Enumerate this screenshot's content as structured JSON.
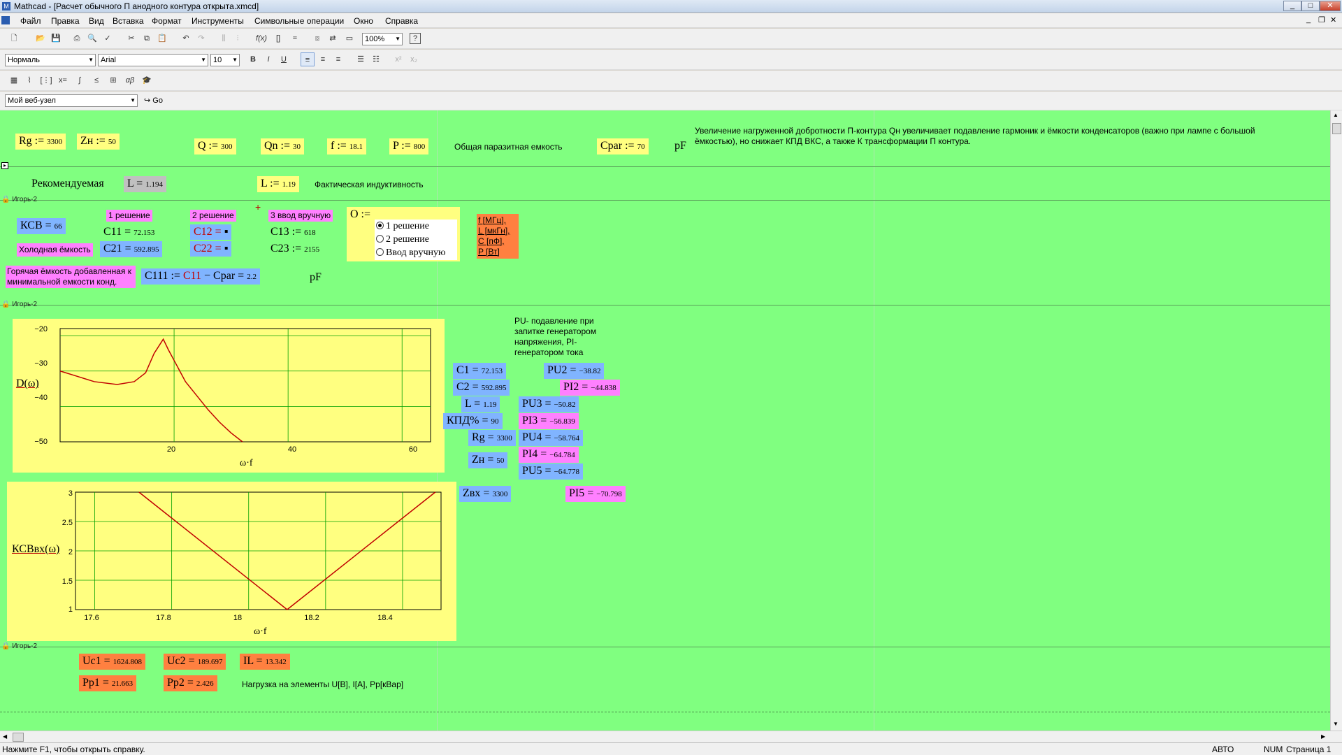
{
  "window": {
    "title": "Mathcad - [Расчет обычного П анодного контура открыта.xmcd]"
  },
  "menu": [
    "Файл",
    "Правка",
    "Вид",
    "Вставка",
    "Формат",
    "Инструменты",
    "Символьные операции",
    "Окно",
    "Справка"
  ],
  "format_bar": {
    "style": "Нормаль",
    "font": "Arial",
    "size": "10",
    "zoom": "100%"
  },
  "web_bar": {
    "site": "Мой веб-узел",
    "go": "Go"
  },
  "region_labels": {
    "r1": "Игорь-2",
    "r2": "Игорь-2",
    "r3": "Игорь-2"
  },
  "row1": {
    "rg": "Rg := ",
    "rg_v": "3300",
    "zn": "Zн := ",
    "zn_v": "50",
    "q": "Q := ",
    "q_v": "300",
    "qn": "Qn := ",
    "qn_v": "30",
    "f": "f := ",
    "f_v": "18.1",
    "p": "P := ",
    "p_v": "800",
    "cpar_label": "Общая паразитная емкость",
    "cpar": "Cpar := ",
    "cpar_v": "70",
    "pf": "pF",
    "note": "Увеличение нагруженной добротности П-контура Qн увеличивает подавление гармоник и ёмкости конденсаторов (важно при лампе с большой ёмкостью), но снижает КПД ВКС, а также К трансформации П контура."
  },
  "row2": {
    "rec": "Рекомендуемая",
    "l": "L = ",
    "l_v": "1.194",
    "lset": "L := ",
    "lset_v": "1.19",
    "lnote": "Фактическая индуктивность"
  },
  "sol": {
    "ksv": "КСВ = ",
    "ksv_v": "66",
    "cold": "Холодная ёмкость",
    "h1": "1 решение",
    "h2": "2 решение",
    "h3": "3 ввод вручную",
    "c11": "C11 = ",
    "c11_v": "72.153",
    "c21": "C21 = ",
    "c21_v": "592.895",
    "c12": "C12 = ",
    "c22": "C22 = ",
    "c13": "C13 := ",
    "c13_v": "618",
    "c23": "C23 := ",
    "c23_v": "2155",
    "o": "O :=",
    "opt1": "1 решение",
    "opt2": "2 решение",
    "opt3": "Ввод вручную",
    "u1": "f [МГц],",
    "u2": "L [мкГн],",
    "u3": "C [пФ],",
    "u4": "P [Вт]",
    "hot": "Горячая ёмкость добавленная к минимальной емкости конд.",
    "c111a": "C111 := ",
    "c111b": "C11",
    "c111c": " − Cpar = ",
    "c111_v": "2.2",
    "pf": "pF"
  },
  "plot1": {
    "ylabel": "D(ω)",
    "xlabel": "ω·f",
    "yticks": [
      "−20",
      "−30",
      "−40",
      "−50"
    ],
    "xticks": [
      "20",
      "40",
      "60"
    ]
  },
  "plot2": {
    "ylabel": "КСВвх(ω)",
    "xlabel": "ω·f",
    "yticks": [
      "3",
      "2.5",
      "2",
      "1.5",
      "1"
    ],
    "xticks": [
      "17.6",
      "17.8",
      "18",
      "18.2",
      "18.4"
    ]
  },
  "results": {
    "note": "PU- подавление при запитке генератором напряжения, PI- генератором тока",
    "c1": "C1 = ",
    "c1_v": "72.153",
    "c2": "C2 = ",
    "c2_v": "592.895",
    "l": "L = ",
    "l_v": "1.19",
    "kpd": "КПД% = ",
    "kpd_v": "90",
    "rg": "Rg = ",
    "rg_v": "3300",
    "zn": "Zн = ",
    "zn_v": "50",
    "zvx": "Zвх = ",
    "zvx_v": "3300",
    "pu2": "PU2 = ",
    "pu2_v": "−38.82",
    "pi2": "PI2 = ",
    "pi2_v": "−44.838",
    "pu3": "PU3 = ",
    "pu3_v": "−50.82",
    "pi3": "PI3 = ",
    "pi3_v": "−56.839",
    "pu4": "PU4 = ",
    "pu4_v": "−58.764",
    "pi4": "PI4 = ",
    "pi4_v": "−64.784",
    "pu5": "PU5 = ",
    "pu5_v": "−64.778",
    "pi5": "PI5 = ",
    "pi5_v": "−70.798"
  },
  "loads": {
    "uc1": "Uc1 = ",
    "uc1_v": "1624.808",
    "uc2": "Uc2 = ",
    "uc2_v": "189.697",
    "il": "IL = ",
    "il_v": "13.342",
    "pp1": "Pp1 = ",
    "pp1_v": "21.663",
    "pp2": "Pp2 = ",
    "pp2_v": "2.426",
    "note": "Нагрузка на элементы U[В], I[А], Pp[кВар]"
  },
  "status": {
    "help": "Нажмите F1, чтобы открыть справку.",
    "auto": "АВТО",
    "num": "NUM",
    "page": "Страница 1"
  },
  "chart_data": [
    {
      "type": "line",
      "ylabel": "D(ω)",
      "xlabel": "ω·f",
      "xlim": [
        0,
        65
      ],
      "ylim": [
        -50,
        -18
      ],
      "series": [
        {
          "points": [
            [
              0,
              -30
            ],
            [
              3,
              -31.5
            ],
            [
              6,
              -33
            ],
            [
              10,
              -33.8
            ],
            [
              13,
              -33
            ],
            [
              15,
              -30.5
            ],
            [
              16.5,
              -25
            ],
            [
              18.1,
              -21
            ],
            [
              19,
              -24
            ],
            [
              20,
              -27
            ],
            [
              22,
              -33
            ],
            [
              24,
              -37
            ],
            [
              26,
              -41
            ],
            [
              28,
              -44.5
            ],
            [
              30,
              -47.5
            ],
            [
              32,
              -50
            ]
          ]
        }
      ]
    },
    {
      "type": "line",
      "ylabel": "КСВвх(ω)",
      "xlabel": "ω·f",
      "xlim": [
        17.55,
        18.5
      ],
      "ylim": [
        1,
        3
      ],
      "series": [
        {
          "points": [
            [
              17.715,
              3
            ],
            [
              18.1,
              1
            ],
            [
              18.485,
              3
            ]
          ]
        }
      ]
    }
  ]
}
